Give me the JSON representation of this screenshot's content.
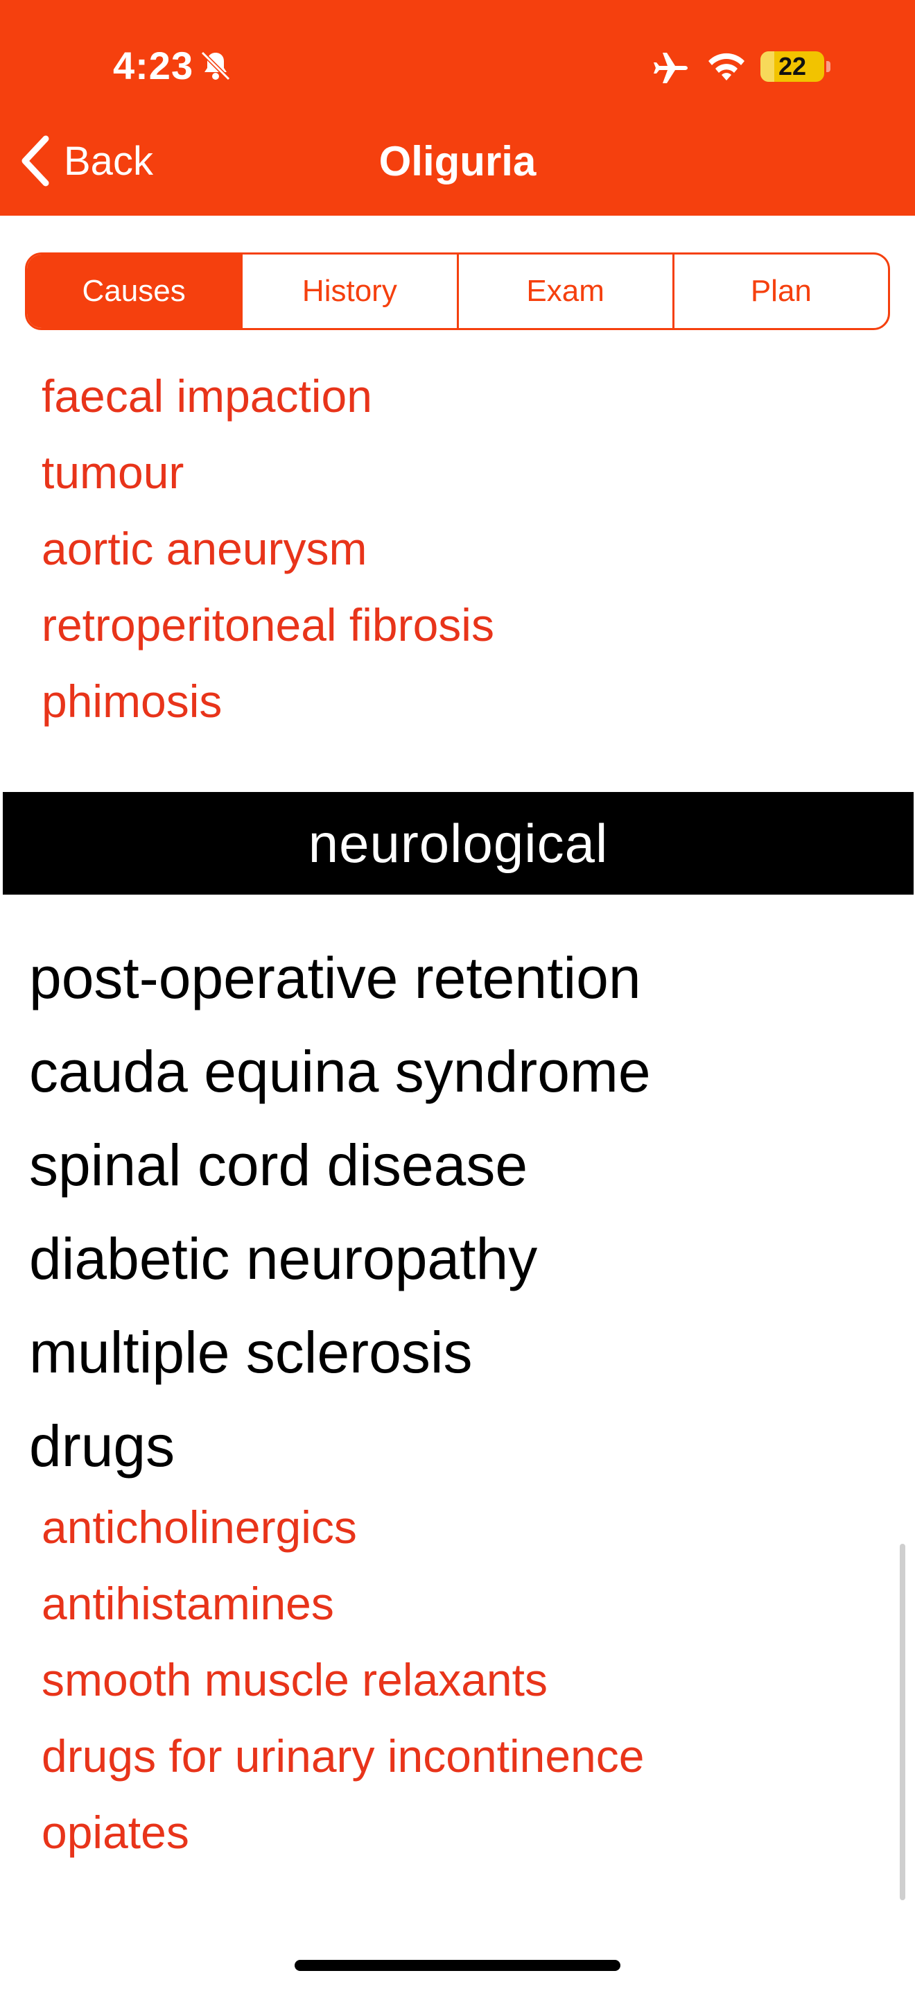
{
  "status_bar": {
    "time": "4:23",
    "battery_percent": "22",
    "battery_level": 0.22,
    "icons": [
      "bell-slash-icon",
      "airplane-icon",
      "wifi-icon",
      "battery-icon"
    ]
  },
  "nav": {
    "back_label": "Back",
    "title": "Oliguria"
  },
  "tabs": [
    {
      "label": "Causes",
      "active": true
    },
    {
      "label": "History",
      "active": false
    },
    {
      "label": "Exam",
      "active": false
    },
    {
      "label": "Plan",
      "active": false
    }
  ],
  "top_red_items": [
    "faecal impaction",
    "tumour",
    "aortic aneurysm",
    "retroperitoneal fibrosis",
    "phimosis"
  ],
  "section_header": "neurological",
  "black_items": [
    "post-operative retention",
    "cauda equina syndrome",
    "spinal cord disease",
    "diabetic neuropathy",
    "multiple sclerosis",
    "drugs"
  ],
  "drug_items": [
    "anticholinergics",
    "antihistamines",
    "smooth muscle relaxants",
    "drugs for urinary incontinence",
    "opiates"
  ],
  "colors": {
    "accent": "#F5400E",
    "link_red": "#E8341A",
    "section_bg": "#000000"
  }
}
